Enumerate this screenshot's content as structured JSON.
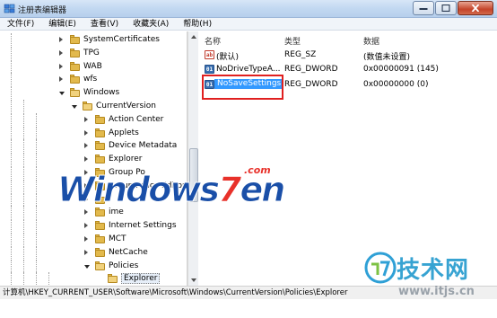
{
  "window": {
    "title": "注册表编辑器",
    "buttons": {
      "minimize": "minimize-icon",
      "maximize": "maximize-icon",
      "close": "close-icon"
    }
  },
  "menu": [
    "文件(F)",
    "编辑(E)",
    "查看(V)",
    "收藏夹(A)",
    "帮助(H)"
  ],
  "tree": {
    "items": [
      {
        "label": "SystemCertificates",
        "expanded": false
      },
      {
        "label": "TPG",
        "expanded": false
      },
      {
        "label": "WAB",
        "expanded": false
      },
      {
        "label": "wfs",
        "expanded": false
      },
      {
        "label": "Windows",
        "expanded": true
      },
      {
        "label": "CurrentVersion",
        "expanded": true
      },
      {
        "label": "Action Center",
        "expanded": false
      },
      {
        "label": "Applets",
        "expanded": false
      },
      {
        "label": "Device Metadata",
        "expanded": false
      },
      {
        "label": "Explorer",
        "expanded": false
      },
      {
        "label": "Group Po",
        "expanded": false
      },
      {
        "label": "Group Policy Editor",
        "expanded": false
      },
      {
        "label": "",
        "expanded": false
      },
      {
        "label": "ime",
        "expanded": false
      },
      {
        "label": "Internet Settings",
        "expanded": false
      },
      {
        "label": "MCT",
        "expanded": false
      },
      {
        "label": "NetCache",
        "expanded": false
      },
      {
        "label": "Policies",
        "expanded": true
      },
      {
        "label": "Explorer",
        "expanded": false,
        "selected": true
      }
    ]
  },
  "values_pane": {
    "headers": {
      "name": "名称",
      "type": "类型",
      "data": "数据"
    },
    "rows": [
      {
        "icon": "string-value-icon",
        "name": "(默认)",
        "type": "REG_SZ",
        "data": "(数值未设置)"
      },
      {
        "icon": "dword-value-icon",
        "name": "NoDriveTypeA...",
        "type": "REG_DWORD",
        "data": "0x00000091 (145)"
      },
      {
        "icon": "dword-value-icon",
        "name": "NoSaveSettings",
        "type": "REG_DWORD",
        "data": "0x00000000 (0)",
        "selected": true
      }
    ]
  },
  "status": {
    "path": "计算机\\HKEY_CURRENT_USER\\Software\\Microsoft\\Windows\\CurrentVersion\\Policies\\Explorer"
  },
  "watermarks": {
    "main_prefix": "Windows",
    "main_number": "7",
    "main_suffix": "en",
    "main_com": ".com",
    "corner_text": "技术网",
    "corner_url": "www.itjs.cn"
  },
  "colors": {
    "selection": "#3399ff",
    "highlight_border": "#e02020",
    "folder": "#e2b94c"
  }
}
